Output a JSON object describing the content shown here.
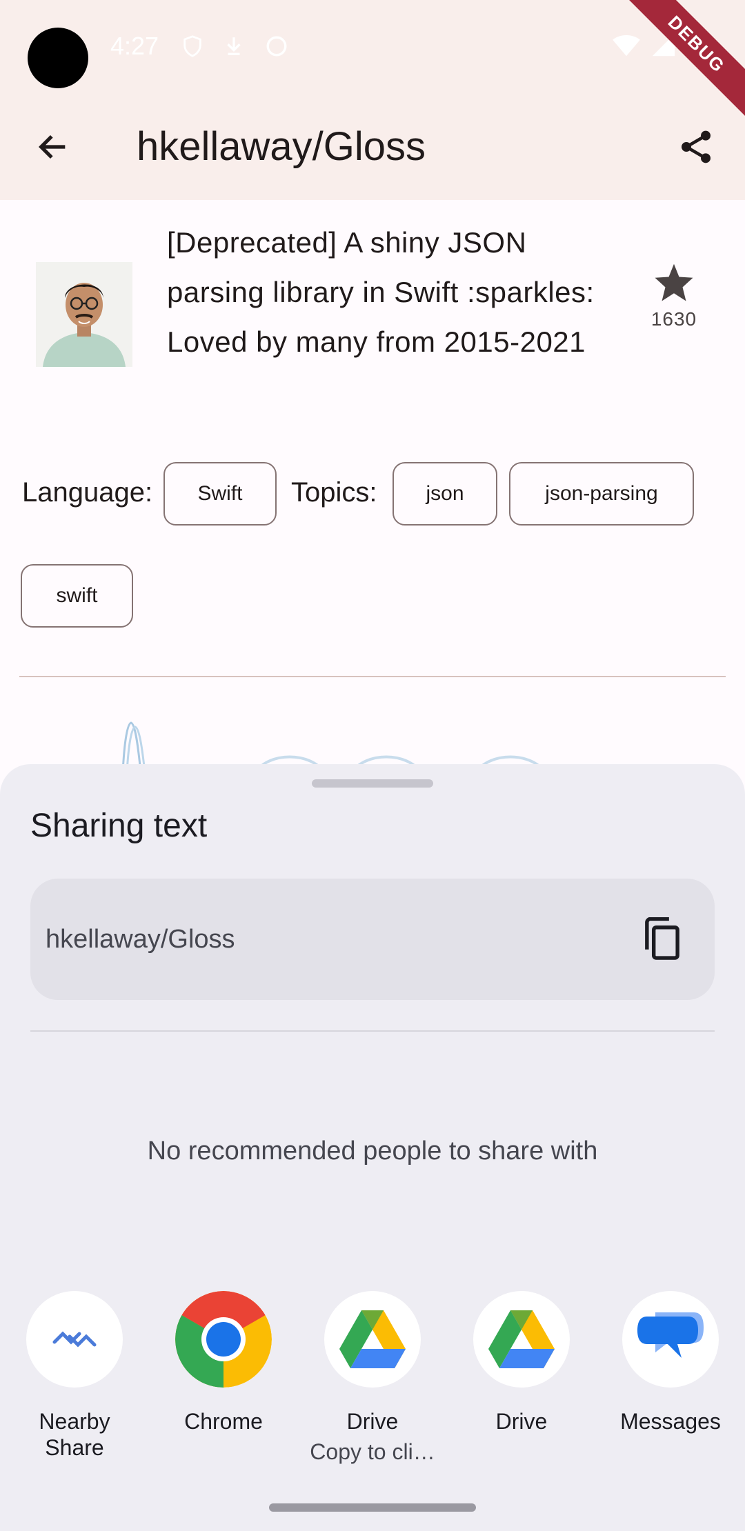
{
  "status_bar": {
    "time": "4:27",
    "debug_banner": "DEBUG"
  },
  "app_bar": {
    "title": "hkellaway/Gloss"
  },
  "repo": {
    "description": "[Deprecated] A shiny JSON parsing library in Swift :sparkles: Loved by many from 2015-2021",
    "stars": "1630",
    "language_label": "Language:",
    "language": "Swift",
    "topics_label": "Topics:",
    "topics": [
      "json",
      "json-parsing",
      "swift"
    ]
  },
  "share_sheet": {
    "title": "Sharing text",
    "shared_text": "hkellaway/Gloss",
    "empty_people": "No recommended people to share with",
    "targets": [
      {
        "label": "Nearby\nShare",
        "sub": "",
        "icon": "nearby-share-icon"
      },
      {
        "label": "Chrome",
        "sub": "",
        "icon": "chrome-icon"
      },
      {
        "label": "Drive",
        "sub": "Copy to cli…",
        "icon": "drive-icon"
      },
      {
        "label": "Drive",
        "sub": "",
        "icon": "drive-icon"
      },
      {
        "label": "Messages",
        "sub": "",
        "icon": "messages-icon"
      }
    ]
  },
  "colors": {
    "app_bar_bg": "#f9eeeb",
    "sheet_bg": "#eeedf3",
    "debug": "#a4283a"
  }
}
